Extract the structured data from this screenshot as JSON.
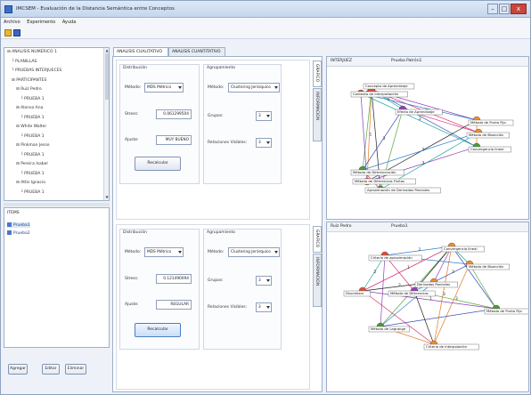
{
  "window": {
    "title": "IMCSEM - Evaluación de la Distancia Semántica entre Conceptos",
    "min": "–",
    "max": "□",
    "close": "x"
  },
  "menu": [
    "Archivo",
    "Experimento",
    "Ayuda"
  ],
  "tree": [
    {
      "label": "ANALISIS NUMERICO 1",
      "depth": 0,
      "marker": "-"
    },
    {
      "label": "PLANILLAS",
      "depth": 1,
      "marker": ""
    },
    {
      "label": "PRUEBAS INTERJUECES",
      "depth": 1,
      "marker": ""
    },
    {
      "label": "PARTICIPANTES",
      "depth": 1,
      "marker": "-"
    },
    {
      "label": "Ruiz Pedro",
      "depth": 2,
      "marker": "-"
    },
    {
      "label": "PRUEBA 1",
      "depth": 3,
      "marker": ""
    },
    {
      "label": "Alonso Ana",
      "depth": 2,
      "marker": "-"
    },
    {
      "label": "PRUEBA 1",
      "depth": 3,
      "marker": ""
    },
    {
      "label": "White Walter",
      "depth": 2,
      "marker": "-"
    },
    {
      "label": "PRUEBA 1",
      "depth": 3,
      "marker": ""
    },
    {
      "label": "Pinkman Jesse",
      "depth": 2,
      "marker": "-"
    },
    {
      "label": "PRUEBA 1",
      "depth": 3,
      "marker": ""
    },
    {
      "label": "Pereira Isabel",
      "depth": 2,
      "marker": "-"
    },
    {
      "label": "PRUEBA 1",
      "depth": 3,
      "marker": ""
    },
    {
      "label": "Attis Ignacio",
      "depth": 2,
      "marker": "-"
    },
    {
      "label": "PRUEBA 1",
      "depth": 3,
      "marker": ""
    }
  ],
  "items_panel": {
    "header": "ITEMS",
    "items": [
      "Prueba1",
      "Prueba2"
    ],
    "buttons": [
      "Agregar",
      "Editar",
      "Eliminar"
    ]
  },
  "tabs": [
    "ANALISIS CUALITATIVO",
    "ANALISIS CUANTITATIVO"
  ],
  "analysis": [
    {
      "dist_title": "Distribución",
      "metodo_label": "Método:",
      "metodo_value": "MDS Métrico",
      "stress_label": "Stress:",
      "stress_value": "0.061299504",
      "ajuste_label": "Ajuste:",
      "ajuste_value": "MUY BUENO",
      "button": "Recalcular",
      "agr_title": "Agrupamiento",
      "agr_metodo_label": "Método:",
      "agr_metodo_value": "Clustering Jerárquico",
      "grupos_label": "Grupos:",
      "grupos_value": "3",
      "rel_label": "Relaciones Visibles:",
      "rel_value": "3",
      "vtab_graf": "GRAFICO",
      "vtab_info": "INFORMACION"
    },
    {
      "dist_title": "Distribución",
      "metodo_label": "Método:",
      "metodo_value": "MDS Métrico",
      "stress_label": "Stress:",
      "stress_value": "0.121490094",
      "ajuste_label": "Ajuste:",
      "ajuste_value": "REGULAR",
      "button": "Recalcular",
      "agr_title": "Agrupamiento",
      "agr_metodo_label": "Método:",
      "agr_metodo_value": "Clustering Jerárquico",
      "grupos_label": "Grupos:",
      "grupos_value": "3",
      "rel_label": "Relaciones Visibles:",
      "rel_value": "3",
      "vtab_graf": "GRAFICO",
      "vtab_info": "INFORMACION"
    }
  ],
  "graphs": [
    {
      "col1": "INTERJUEZ",
      "col2": "Prueba Patrón1",
      "nodes": [
        {
          "label": "Concepto de Aprendizaje",
          "color": "#e0503a"
        },
        {
          "label": "Contexto de Interpretación",
          "color": "#e0503a"
        },
        {
          "label": "Efecto de Aprendizaje",
          "color": "#9a3fb5"
        },
        {
          "label": "Método de Punto Fijo",
          "color": "#f08c2a"
        },
        {
          "label": "Método de Bisección",
          "color": "#f08c2a"
        },
        {
          "label": "Convergencia lineal",
          "color": "#4a9b3a"
        },
        {
          "label": "Método de Diferenciación",
          "color": "#4a9b3a"
        },
        {
          "label": "Método de Diferencias Finitas",
          "color": "#f08c2a"
        },
        {
          "label": "Aproximación de Derivadas Parciales",
          "color": "#4a9b3a"
        }
      ],
      "edge_labels": [
        "2",
        "3",
        "1",
        "2",
        "3",
        "2",
        "3",
        "1"
      ]
    },
    {
      "col1": "Ruiz Pedro",
      "col2": "Prueba1",
      "nodes": [
        {
          "label": "Convergencia lineal",
          "color": "#f08c2a"
        },
        {
          "label": "Criterio de aproximación",
          "color": "#e0503a"
        },
        {
          "label": "Método de Bisección",
          "color": "#f08c2a"
        },
        {
          "label": "Derivadas Parciales",
          "color": "#f08c2a"
        },
        {
          "label": "Discretizar",
          "color": "#e0503a"
        },
        {
          "label": "Método de Punto Fijo",
          "color": "#4a9b3a"
        },
        {
          "label": "Método de Lagrange",
          "color": "#4a9b3a"
        },
        {
          "label": "Criterio de interpolación",
          "color": "#f08c2a"
        },
        {
          "label": "Método de Diferencias",
          "color": "#9a3fb5"
        }
      ],
      "edge_labels": [
        "2",
        "1",
        "3",
        "2",
        "3",
        "2",
        "1",
        "3"
      ]
    }
  ]
}
